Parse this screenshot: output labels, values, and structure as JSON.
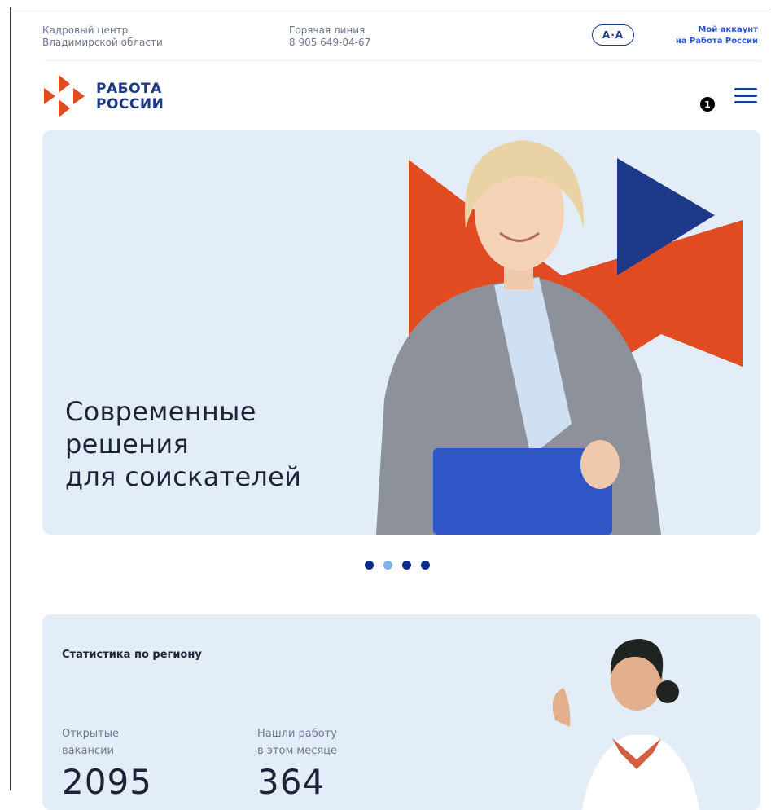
{
  "top_bar": {
    "center_line1": "Кадровый центр",
    "center_line2": "Владимирской области",
    "hotline_label": "Горячая линия",
    "hotline_phone": "8 905 649-04-67",
    "font_toggle": "A·A",
    "account_line1": "Мой аккаунт",
    "account_line2": "на Работа России"
  },
  "header": {
    "logo_line1": "РАБОТА",
    "logo_line2": "РОССИИ",
    "notification_count": "1"
  },
  "hero": {
    "title_line1": "Современные",
    "title_line2": "решения",
    "title_line3": "для соискателей",
    "slides": 4,
    "active_slide": 2
  },
  "stats": {
    "title": "Статистика по региону",
    "items": [
      {
        "label_line1": "Открытые",
        "label_line2": "вакансии",
        "value": "2095"
      },
      {
        "label_line1": "Нашли работу",
        "label_line2": "в этом месяце",
        "value": "364"
      }
    ]
  },
  "colors": {
    "brand_blue": "#1d3a8a",
    "brand_red": "#e04b22",
    "hero_bg": "#e3edf8",
    "link_blue": "#2d54c8"
  }
}
